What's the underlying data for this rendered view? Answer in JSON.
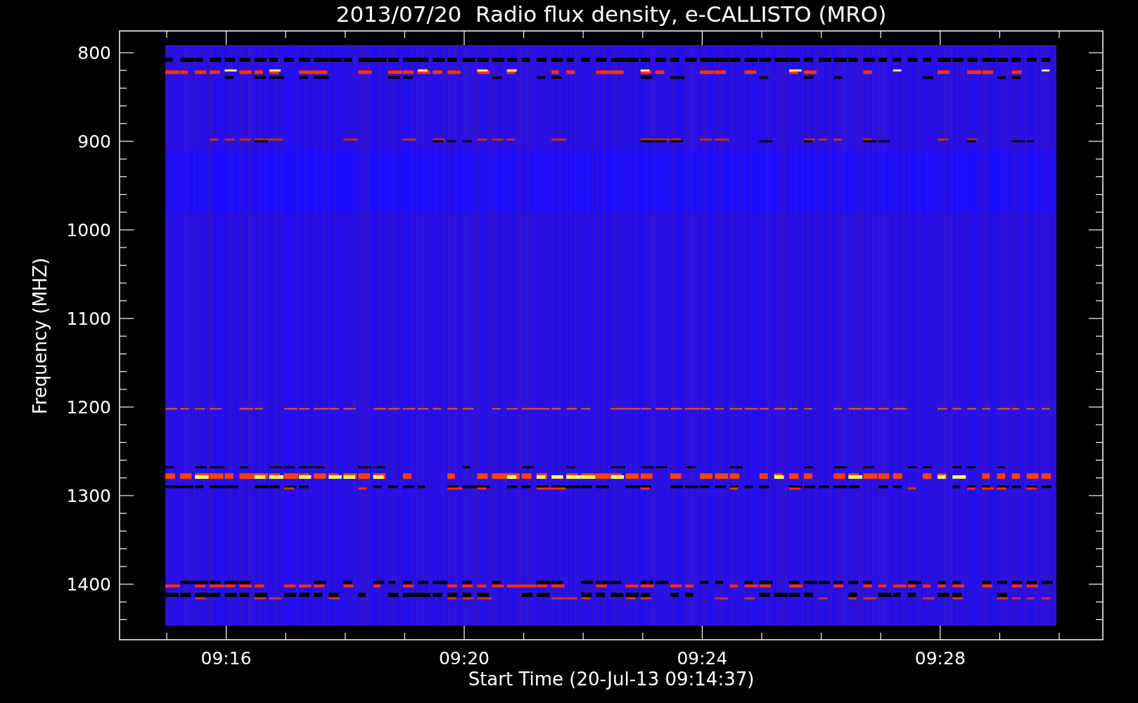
{
  "title": "2013/07/20  Radio flux density, e-CALLISTO (MRO)",
  "ylabel": "Frequency (MHZ)",
  "xlabel": "Start Time (20-Jul-13 09:14:37)",
  "yticks": [
    "800",
    "900",
    "1000",
    "1100",
    "1200",
    "1300",
    "1400"
  ],
  "xticks": [
    "09:16",
    "09:20",
    "09:24",
    "09:28"
  ]
}
